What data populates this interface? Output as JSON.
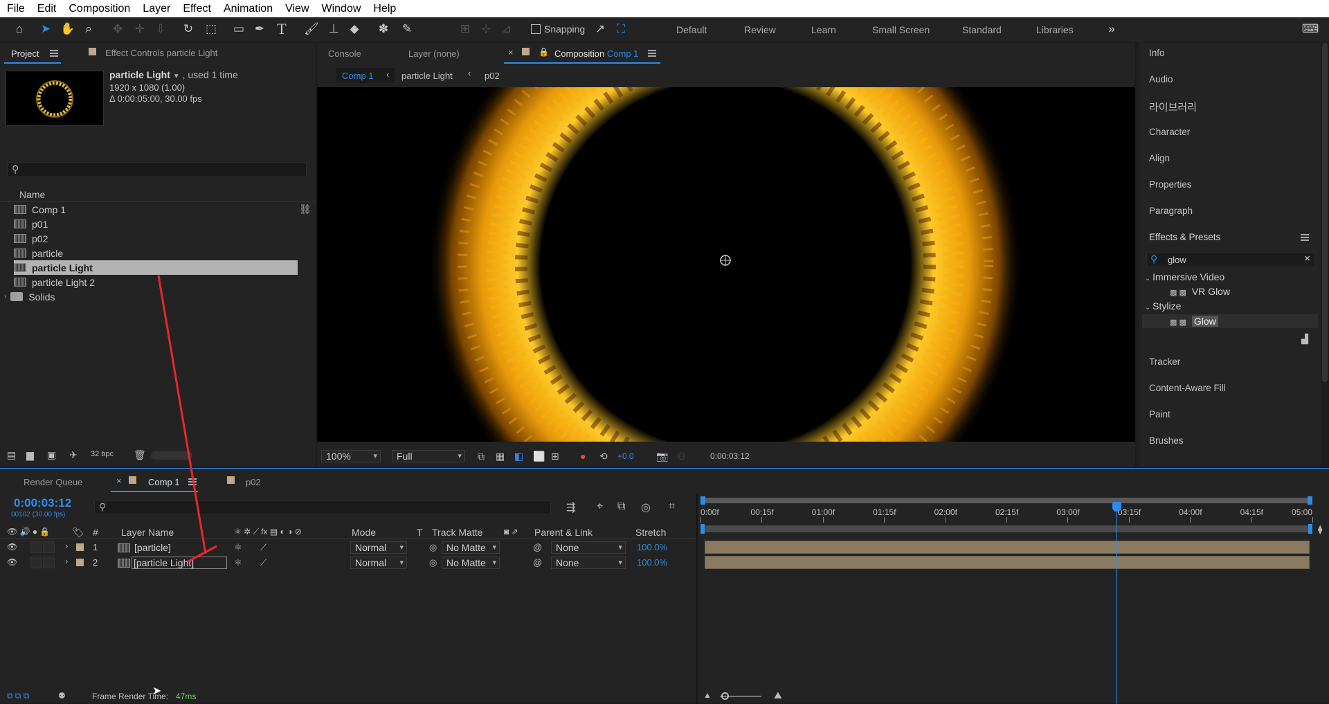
{
  "menu": [
    "File",
    "Edit",
    "Composition",
    "Layer",
    "Effect",
    "Animation",
    "View",
    "Window",
    "Help"
  ],
  "toolbar": {
    "snapping": "Snapping",
    "workspaces": [
      "Default",
      "Review",
      "Learn",
      "Small Screen",
      "Standard",
      "Libraries"
    ]
  },
  "project": {
    "tab": "Project",
    "effect_controls": "Effect Controls particle Light",
    "selected_name": "particle Light",
    "used": ", used 1 time",
    "dims": "1920 x 1080 (1.00)",
    "duration": "Δ 0:00:05:00, 30.00 fps",
    "column_name": "Name",
    "items": [
      "Comp 1",
      "p01",
      "p02",
      "particle",
      "particle Light",
      "particle Light 2",
      "Solids"
    ],
    "bpc": "32 bpc"
  },
  "viewer": {
    "tabs": {
      "console": "Console",
      "layer": "Layer (none)",
      "composition": "Composition",
      "comp_name": "Comp 1"
    },
    "breadcrumbs": [
      "Comp 1",
      "particle Light",
      "p02"
    ],
    "zoom": "100%",
    "resolution": "Full",
    "exposure": "+0.0",
    "timecode": "0:00:03:12"
  },
  "right_panel": {
    "items": [
      "Info",
      "Audio",
      "라이브러리",
      "Character",
      "Align",
      "Properties",
      "Paragraph"
    ],
    "effects_title": "Effects & Presets",
    "search": "glow",
    "groups": [
      {
        "name": "Immersive Video",
        "effect": "VR Glow"
      },
      {
        "name": "Stylize",
        "effect": "Glow"
      }
    ],
    "items2": [
      "Tracker",
      "Content-Aware Fill",
      "Paint",
      "Brushes"
    ]
  },
  "timeline": {
    "render_queue": "Render Queue",
    "comp_tab": "Comp 1",
    "p02_tab": "p02",
    "timecode": "0:00:03:12",
    "frames": "00102 (30.00 fps)",
    "cols": {
      "num": "#",
      "layer_name": "Layer Name",
      "mode": "Mode",
      "t": "T",
      "track_matte": "Track Matte",
      "parent": "Parent & Link",
      "stretch": "Stretch"
    },
    "layers": [
      {
        "num": "1",
        "name": "[particle]",
        "mode": "Normal",
        "matte": "No Matte",
        "parent": "None",
        "stretch": "100.0%"
      },
      {
        "num": "2",
        "name": "[particle Light]",
        "mode": "Normal",
        "matte": "No Matte",
        "parent": "None",
        "stretch": "100.0%"
      }
    ],
    "ruler": [
      "0:00f",
      "00:15f",
      "01:00f",
      "01:15f",
      "02:00f",
      "02:15f",
      "03:00f",
      "03:15f",
      "04:00f",
      "04:15f",
      "05:00"
    ],
    "playhead_fraction": 0.68,
    "status": "Frame Render Time:",
    "render_time": "47ms"
  },
  "colors": {
    "accent": "#2d8ceb",
    "clip": "#8b7a62",
    "selected": "#b3b3b3"
  }
}
